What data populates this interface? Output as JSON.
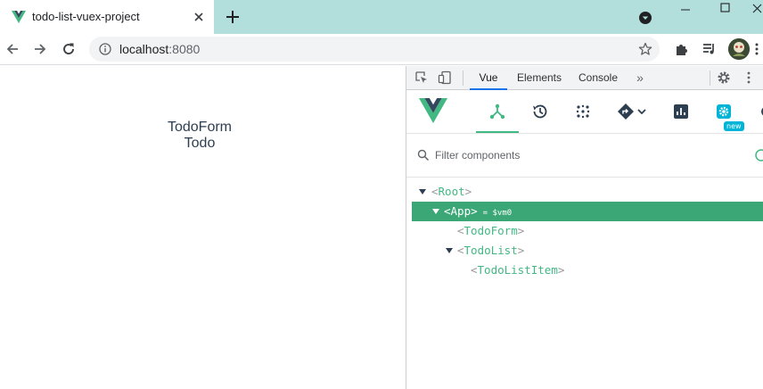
{
  "browser": {
    "tab_title": "todo-list-vuex-project",
    "url_host": "localhost",
    "url_port": ":8080"
  },
  "page": {
    "lines": [
      "TodoForm",
      "Todo"
    ]
  },
  "devtools": {
    "tabs": [
      "Vue",
      "Elements",
      "Console"
    ],
    "more": "»",
    "active_tab": "Vue",
    "vue_toolbar": {
      "new_badge": "new"
    },
    "filter_placeholder": "Filter components",
    "tree": {
      "root": "Root",
      "app": "App",
      "app_vm": "= $vm0",
      "todoform": "TodoForm",
      "todolist": "TodoList",
      "todolistitem": "TodoListItem"
    },
    "brackets": {
      "open": "<",
      "close": ">"
    }
  },
  "colors": {
    "titlebar": "#b2dfdb",
    "vue_green": "#42b883",
    "selected_row": "#3ba776",
    "active_tab_underline": "#1a73e8"
  },
  "icons": [
    "vue-favicon-icon",
    "close-icon",
    "plus-icon",
    "tab-search-icon",
    "minimize-icon",
    "maximize-icon",
    "close-window-icon",
    "back-icon",
    "forward-icon",
    "reload-icon",
    "info-icon",
    "star-icon",
    "puzzle-icon",
    "media-icon",
    "avatar",
    "more-vert-icon",
    "inspect-icon",
    "device-icon",
    "gear-icon",
    "vue-logo-icon",
    "components-icon",
    "timeline-icon",
    "vuex-icon",
    "routing-icon",
    "chevron-down-icon",
    "performance-icon",
    "settings-icon",
    "refresh-icon",
    "search-icon",
    "select-component-icon"
  ]
}
